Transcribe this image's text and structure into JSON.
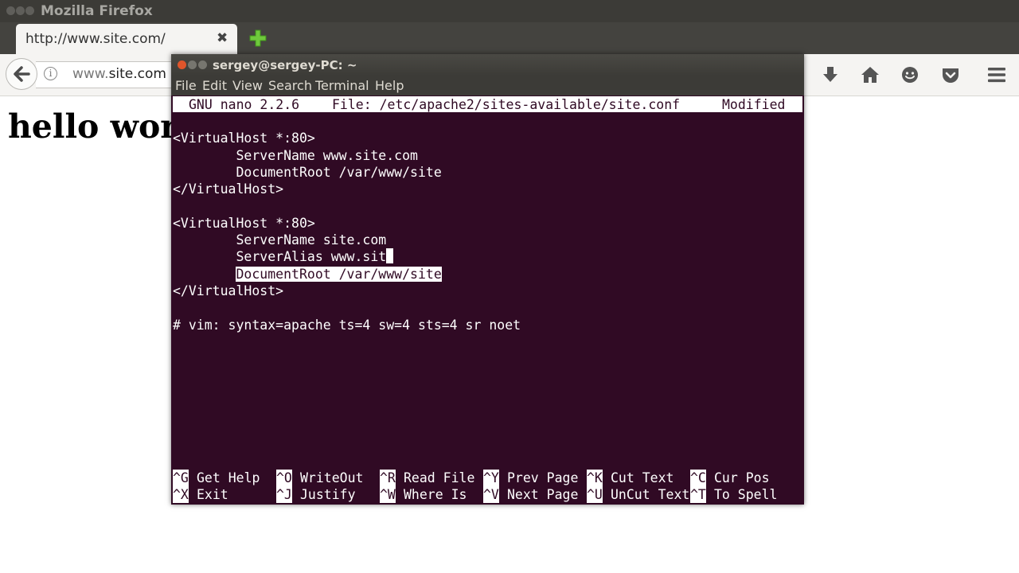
{
  "firefox": {
    "window_title": "Mozilla Firefox",
    "tab_title": "http://www.site.com/",
    "tab_close": "✖",
    "url_prefix": "www.",
    "url_domain": "site.com",
    "info_icon": "i",
    "page_heading": "hello world",
    "icons": [
      "back-arrow-icon",
      "info-icon",
      "download-icon",
      "home-icon",
      "hello-icon",
      "pocket-icon",
      "menu-icon",
      "new-tab-plus-icon"
    ]
  },
  "terminal": {
    "window_title": "sergey@sergey-PC: ~",
    "menu": [
      "File",
      "Edit",
      "View",
      "Search",
      "Terminal",
      "Help"
    ],
    "nano": {
      "version": "GNU nano 2.2.6",
      "file": "File: /etc/apache2/sites-available/site.conf",
      "status": "Modified"
    },
    "lines": {
      "l1": "<VirtualHost *:80>",
      "l2": "        ServerName www.site.com",
      "l3": "        DocumentRoot /var/www/site",
      "l4": "</VirtualHost>",
      "l5": "<VirtualHost *:80>",
      "l6": "        ServerName site.com",
      "l7_indent": "        ",
      "l7_text": "ServerAlias www.sit",
      "l8_indent": "        ",
      "l8_text": "DocumentRoot /var/www/site",
      "l9": "</VirtualHost>",
      "l10": "# vim: syntax=apache ts=4 sw=4 sts=4 sr noet"
    },
    "shortcuts": [
      {
        "key": "^G",
        "label": "Get Help"
      },
      {
        "key": "^O",
        "label": "WriteOut"
      },
      {
        "key": "^R",
        "label": "Read File"
      },
      {
        "key": "^Y",
        "label": "Prev Page"
      },
      {
        "key": "^K",
        "label": "Cut Text"
      },
      {
        "key": "^C",
        "label": "Cur Pos"
      },
      {
        "key": "^X",
        "label": "Exit"
      },
      {
        "key": "^J",
        "label": "Justify"
      },
      {
        "key": "^W",
        "label": "Where Is"
      },
      {
        "key": "^V",
        "label": "Next Page"
      },
      {
        "key": "^U",
        "label": "UnCut Text"
      },
      {
        "key": "^T",
        "label": "To Spell"
      }
    ],
    "colors": {
      "background": "#300a24",
      "titlebar": "#3c3b37",
      "close": "#e0552b"
    }
  }
}
